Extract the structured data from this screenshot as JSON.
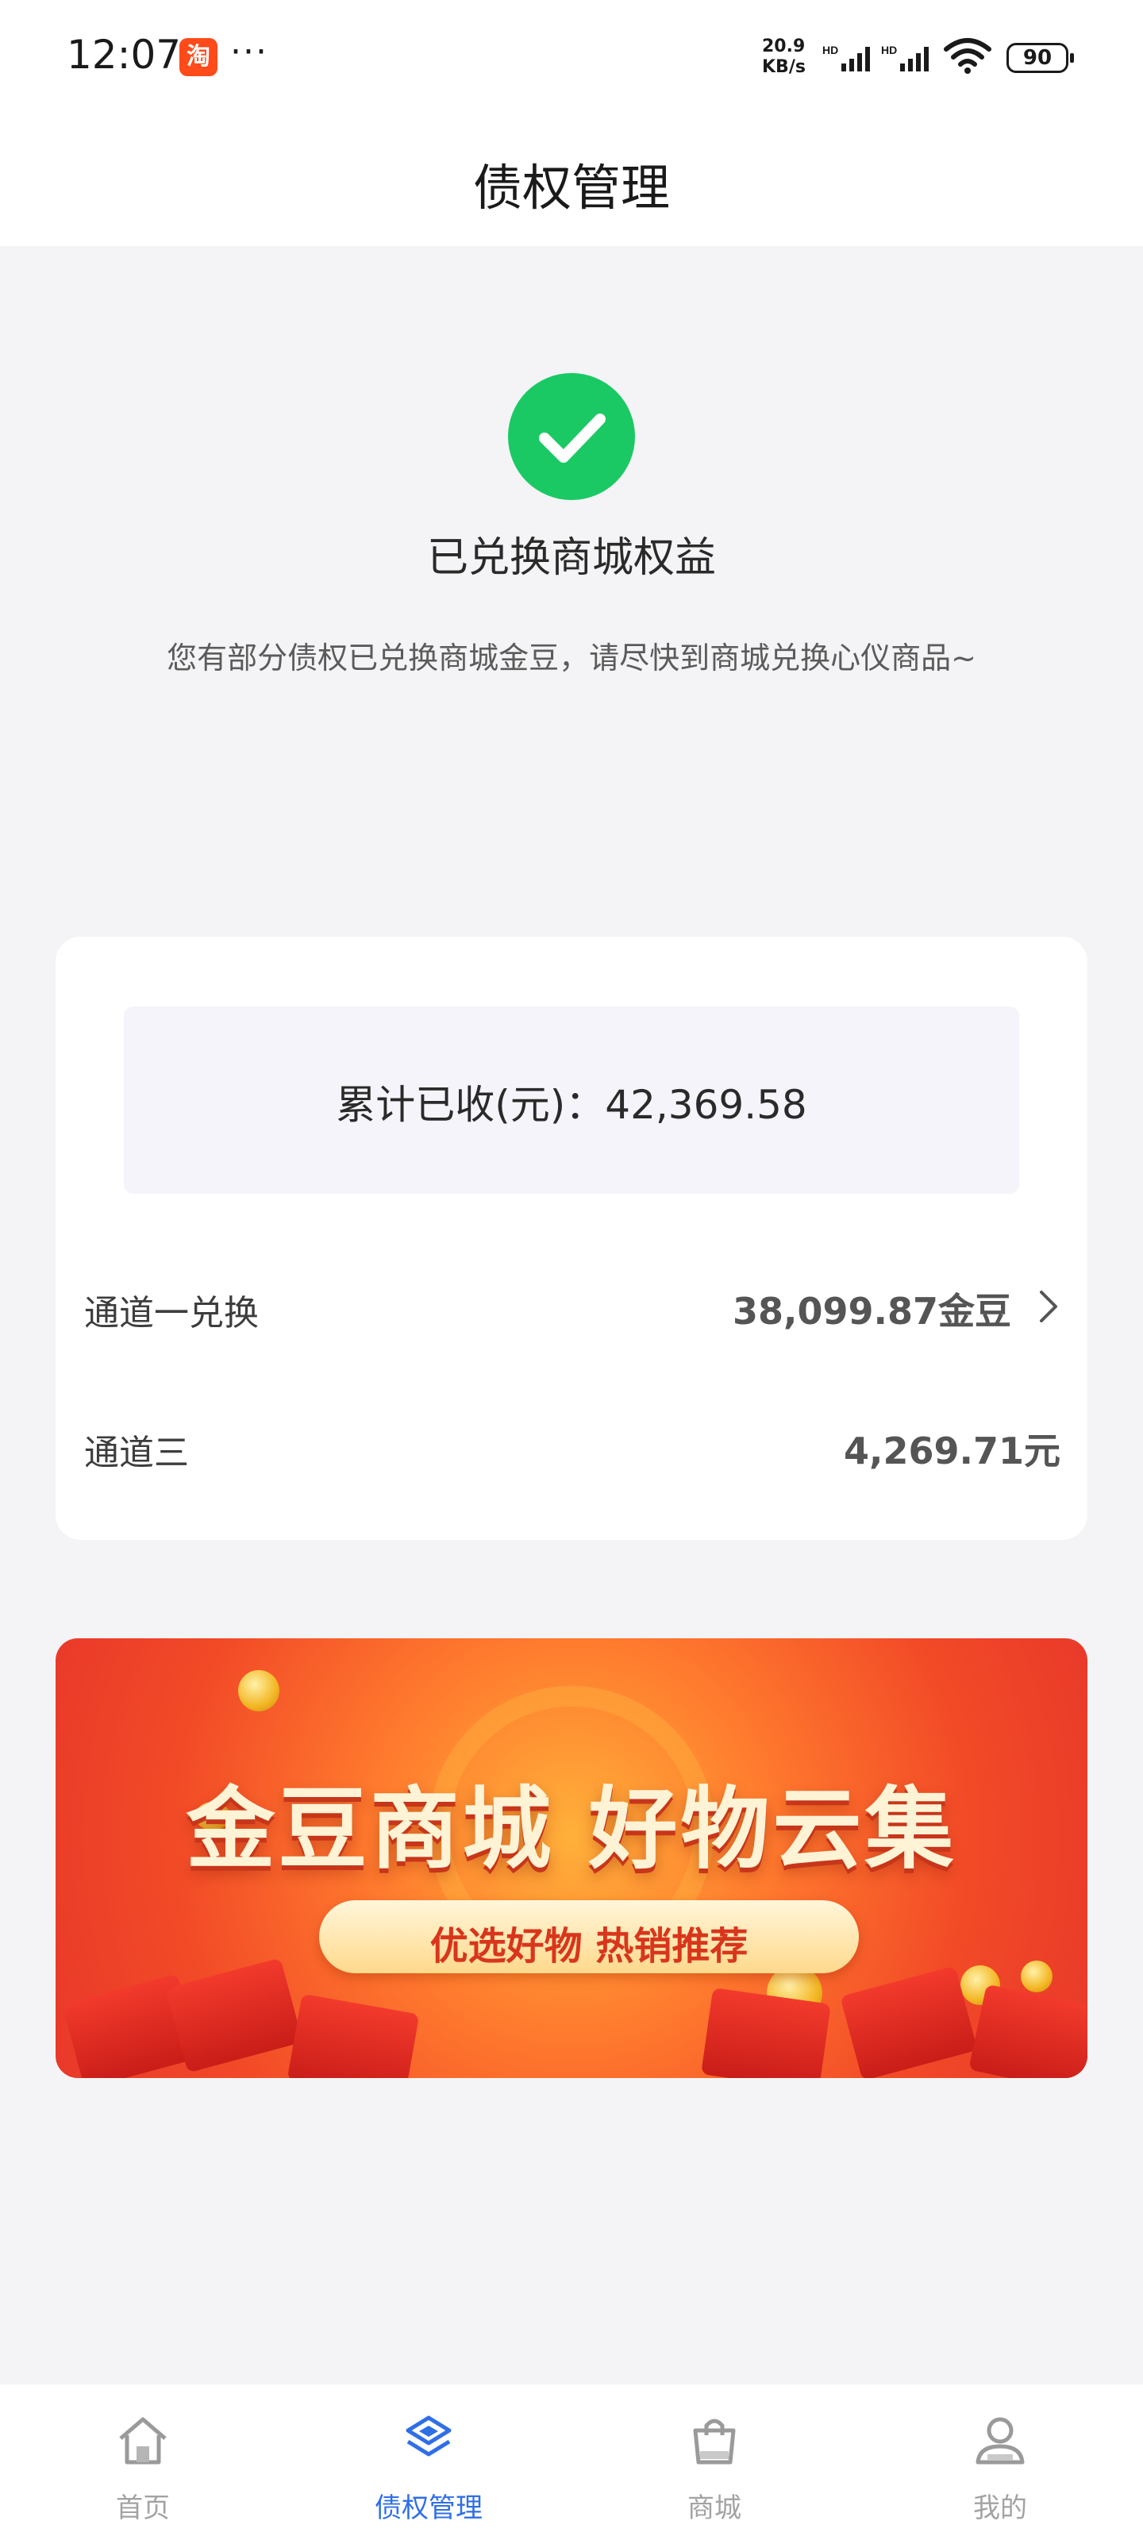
{
  "status_bar": {
    "time": "12:07",
    "app_badge": "淘",
    "more": "···",
    "net_speed_line1": "20.9",
    "net_speed_line2": "KB/s",
    "battery": "90"
  },
  "header": {
    "title": "债权管理"
  },
  "success": {
    "title": "已兑换商城权益",
    "description": "您有部分债权已兑换商城金豆，请尽快到商城兑换心仪商品~"
  },
  "summary": {
    "total_label": "累计已收(元)：42,369.58",
    "rows": [
      {
        "label": "通道一兑换",
        "value": "38,099.87金豆"
      },
      {
        "label": "通道三",
        "value": "4,269.71元"
      }
    ]
  },
  "banner": {
    "title": "金豆商城 好物云集",
    "subtitle": "优选好物 热销推荐"
  },
  "bottom_nav": {
    "items": [
      {
        "label": "首页",
        "icon": "home-icon",
        "active": false
      },
      {
        "label": "债权管理",
        "icon": "layers-icon",
        "active": true
      },
      {
        "label": "商城",
        "icon": "shopping-bag-icon",
        "active": false
      },
      {
        "label": "我的",
        "icon": "user-icon",
        "active": false
      }
    ]
  },
  "colors": {
    "success_green": "#1ac964",
    "active_blue": "#2f6fe6",
    "banner_red": "#f24a27"
  }
}
